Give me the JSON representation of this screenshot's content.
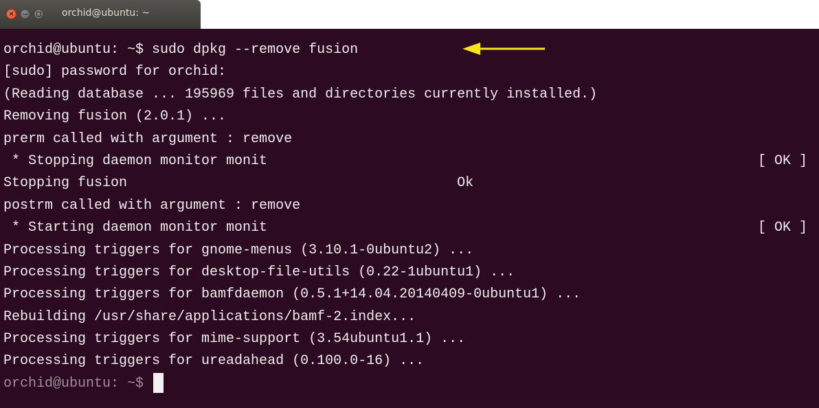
{
  "window": {
    "title": "orchid@ubuntu: ~",
    "close_glyph": "×"
  },
  "terminal": {
    "lines": [
      {
        "text": "orchid@ubuntu: ~$ sudo dpkg --remove fusion",
        "right": ""
      },
      {
        "text": "[sudo] password for orchid:",
        "right": ""
      },
      {
        "text": "(Reading database ... 195969 files and directories currently installed.)",
        "right": ""
      },
      {
        "text": "Removing fusion (2.0.1) ...",
        "right": ""
      },
      {
        "text": "prerm called with argument : remove",
        "right": ""
      },
      {
        "text": " * Stopping daemon monitor monit",
        "right": "[ OK ]"
      },
      {
        "text": "Stopping fusion                                        Ok",
        "right": ""
      },
      {
        "text": "postrm called with argument : remove",
        "right": ""
      },
      {
        "text": " * Starting daemon monitor monit",
        "right": "[ OK ]"
      },
      {
        "text": "Processing triggers for gnome-menus (3.10.1-0ubuntu2) ...",
        "right": ""
      },
      {
        "text": "Processing triggers for desktop-file-utils (0.22-1ubuntu1) ...",
        "right": ""
      },
      {
        "text": "Processing triggers for bamfdaemon (0.5.1+14.04.20140409-0ubuntu1) ...",
        "right": ""
      },
      {
        "text": "Rebuilding /usr/share/applications/bamf-2.index...",
        "right": ""
      },
      {
        "text": "Processing triggers for mime-support (3.54ubuntu1.1) ...",
        "right": ""
      },
      {
        "text": "Processing triggers for ureadahead (0.100.0-16) ...",
        "right": ""
      },
      {
        "text": "orchid@ubuntu: ~$ ",
        "right": ""
      }
    ]
  },
  "colors": {
    "terminal_background": "#2c0a22",
    "terminal_text": "#eeeeec",
    "annotation_arrow": "#f5e61a"
  },
  "icons": {
    "close": "close-icon",
    "minimize": "minimize-icon",
    "maximize": "maximize-icon",
    "annotation": "arrow-left-icon"
  }
}
